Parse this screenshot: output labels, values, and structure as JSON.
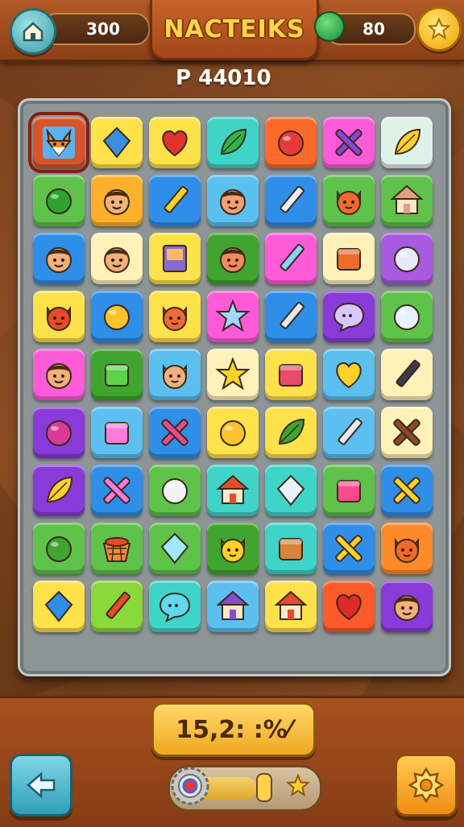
{
  "header": {
    "title": "NACTEIKS",
    "score_value": "300",
    "coin_value": "80",
    "home_icon": "home-icon",
    "coin_icon": "gem-icon",
    "star_icon": "star-icon"
  },
  "level_label": "P 44010",
  "board": {
    "rows": [
      [
        {
          "bg": "#d9532a",
          "icon": "fox-face",
          "fg": "#f08a2a",
          "selected": true
        },
        {
          "bg": "#ffe14a",
          "icon": "diamond",
          "fg": "#3a8ee0"
        },
        {
          "bg": "#ffe14a",
          "icon": "heart",
          "fg": "#e03030"
        },
        {
          "bg": "#3fd4c8",
          "icon": "leaf",
          "fg": "#2fb44a"
        },
        {
          "bg": "#ff6a2a",
          "icon": "circle",
          "fg": "#e83a3a"
        },
        {
          "bg": "#ff5ad8",
          "icon": "cross",
          "fg": "#8a44e0"
        },
        {
          "bg": "#dff2e8",
          "icon": "leaf",
          "fg": "#ffd12a"
        }
      ],
      [
        {
          "bg": "#5fc24a",
          "icon": "circle",
          "fg": "#2fa12f"
        },
        {
          "bg": "#ffb02a",
          "icon": "face",
          "fg": "#f2b07a"
        },
        {
          "bg": "#2f8ee8",
          "icon": "pencil",
          "fg": "#ffd12a"
        },
        {
          "bg": "#5bc0f0",
          "icon": "face",
          "fg": "#f2a070"
        },
        {
          "bg": "#2f8ee8",
          "icon": "pencil",
          "fg": "#e8f0ff"
        },
        {
          "bg": "#5fc24a",
          "icon": "cat-face",
          "fg": "#f06a2a"
        },
        {
          "bg": "#5fc24a",
          "icon": "house",
          "fg": "#e0a080"
        }
      ],
      [
        {
          "bg": "#2f8ee8",
          "icon": "face",
          "fg": "#f2b07a"
        },
        {
          "bg": "#fff2b8",
          "icon": "face",
          "fg": "#f2b07a"
        },
        {
          "bg": "#ffe14a",
          "icon": "book",
          "fg": "#8a6ad0"
        },
        {
          "bg": "#3fa52f",
          "icon": "face",
          "fg": "#f08a5a"
        },
        {
          "bg": "#ff5ad8",
          "icon": "pencil",
          "fg": "#8ad0ff"
        },
        {
          "bg": "#fff2b8",
          "icon": "box",
          "fg": "#f06a2a"
        },
        {
          "bg": "#a85ae0",
          "icon": "circle",
          "fg": "#e8e8ff"
        }
      ],
      [
        {
          "bg": "#ffe14a",
          "icon": "cat-face",
          "fg": "#e84a2a"
        },
        {
          "bg": "#2f8ee8",
          "icon": "circle",
          "fg": "#ffc22a"
        },
        {
          "bg": "#ffe14a",
          "icon": "cat-face",
          "fg": "#f06a3a"
        },
        {
          "bg": "#ff5ad8",
          "icon": "star",
          "fg": "#a0d8ff"
        },
        {
          "bg": "#2f8ee8",
          "icon": "pencil",
          "fg": "#e8e8f0"
        },
        {
          "bg": "#8a3ad8",
          "icon": "bubble",
          "fg": "#d8c8ff"
        },
        {
          "bg": "#5fc24a",
          "icon": "circle",
          "fg": "#e8f2ff"
        }
      ],
      [
        {
          "bg": "#ff5ad8",
          "icon": "face",
          "fg": "#f2b07a"
        },
        {
          "bg": "#3fa52f",
          "icon": "box",
          "fg": "#5fd24a"
        },
        {
          "bg": "#5bc0f0",
          "icon": "cat-face",
          "fg": "#f2b07a"
        },
        {
          "bg": "#fff2b8",
          "icon": "star",
          "fg": "#ffd12a"
        },
        {
          "bg": "#ffe14a",
          "icon": "box",
          "fg": "#e84a6a"
        },
        {
          "bg": "#5bc0f0",
          "icon": "heart",
          "fg": "#ffd12a"
        },
        {
          "bg": "#fff2b8",
          "icon": "pencil",
          "fg": "#3a3a4a"
        }
      ],
      [
        {
          "bg": "#8a3ad8",
          "icon": "circle",
          "fg": "#d83a9a"
        },
        {
          "bg": "#5bc0f0",
          "icon": "box",
          "fg": "#ff7ad8"
        },
        {
          "bg": "#2f8ee8",
          "icon": "cross",
          "fg": "#e84a8a"
        },
        {
          "bg": "#ffe14a",
          "icon": "circle",
          "fg": "#ffc22a"
        },
        {
          "bg": "#ffe14a",
          "icon": "leaf",
          "fg": "#3fa52f"
        },
        {
          "bg": "#5bc0f0",
          "icon": "pencil",
          "fg": "#e8e8f0"
        },
        {
          "bg": "#fff2b8",
          "icon": "cross",
          "fg": "#8a4a2a"
        }
      ],
      [
        {
          "bg": "#8a3ad8",
          "icon": "leaf",
          "fg": "#ffd12a"
        },
        {
          "bg": "#2f8ee8",
          "icon": "cross",
          "fg": "#ff7ad8"
        },
        {
          "bg": "#5fc24a",
          "icon": "circle",
          "fg": "#f2f2f2"
        },
        {
          "bg": "#3fd4c8",
          "icon": "house",
          "fg": "#e84a2a"
        },
        {
          "bg": "#3fd4c8",
          "icon": "diamond",
          "fg": "#e8f2ff"
        },
        {
          "bg": "#5fc24a",
          "icon": "box",
          "fg": "#ff4a8a"
        },
        {
          "bg": "#2f8ee8",
          "icon": "cross",
          "fg": "#ffd12a"
        }
      ],
      [
        {
          "bg": "#5fc24a",
          "icon": "circle",
          "fg": "#3fa52f"
        },
        {
          "bg": "#5fc24a",
          "icon": "basket",
          "fg": "#f08a3a"
        },
        {
          "bg": "#5fc24a",
          "icon": "diamond",
          "fg": "#a0e8ff"
        },
        {
          "bg": "#3fa52f",
          "icon": "cat-face",
          "fg": "#ffd12a"
        },
        {
          "bg": "#3fd4c8",
          "icon": "box",
          "fg": "#d8843a"
        },
        {
          "bg": "#2f8ee8",
          "icon": "cross",
          "fg": "#ffd12a"
        },
        {
          "bg": "#ff8a2a",
          "icon": "cat-face",
          "fg": "#f06a2a"
        }
      ],
      [
        {
          "bg": "#ffe14a",
          "icon": "diamond",
          "fg": "#2f8ee8"
        },
        {
          "bg": "#8ad83a",
          "icon": "pencil",
          "fg": "#e84a2a"
        },
        {
          "bg": "#3fd4c8",
          "icon": "bubble",
          "fg": "#5fd8f0"
        },
        {
          "bg": "#5bc0f0",
          "icon": "house",
          "fg": "#8a4ad0"
        },
        {
          "bg": "#ffe14a",
          "icon": "house",
          "fg": "#e84a2a"
        },
        {
          "bg": "#ff5a2a",
          "icon": "heart",
          "fg": "#e02a2a"
        },
        {
          "bg": "#8a3ad8",
          "icon": "face",
          "fg": "#f2b07a"
        }
      ]
    ]
  },
  "bottom": {
    "timer_text": "15,2: :%⁄",
    "progress_fraction": 0.6,
    "back_icon": "arrow-left-icon",
    "settings_icon": "gear-icon"
  }
}
